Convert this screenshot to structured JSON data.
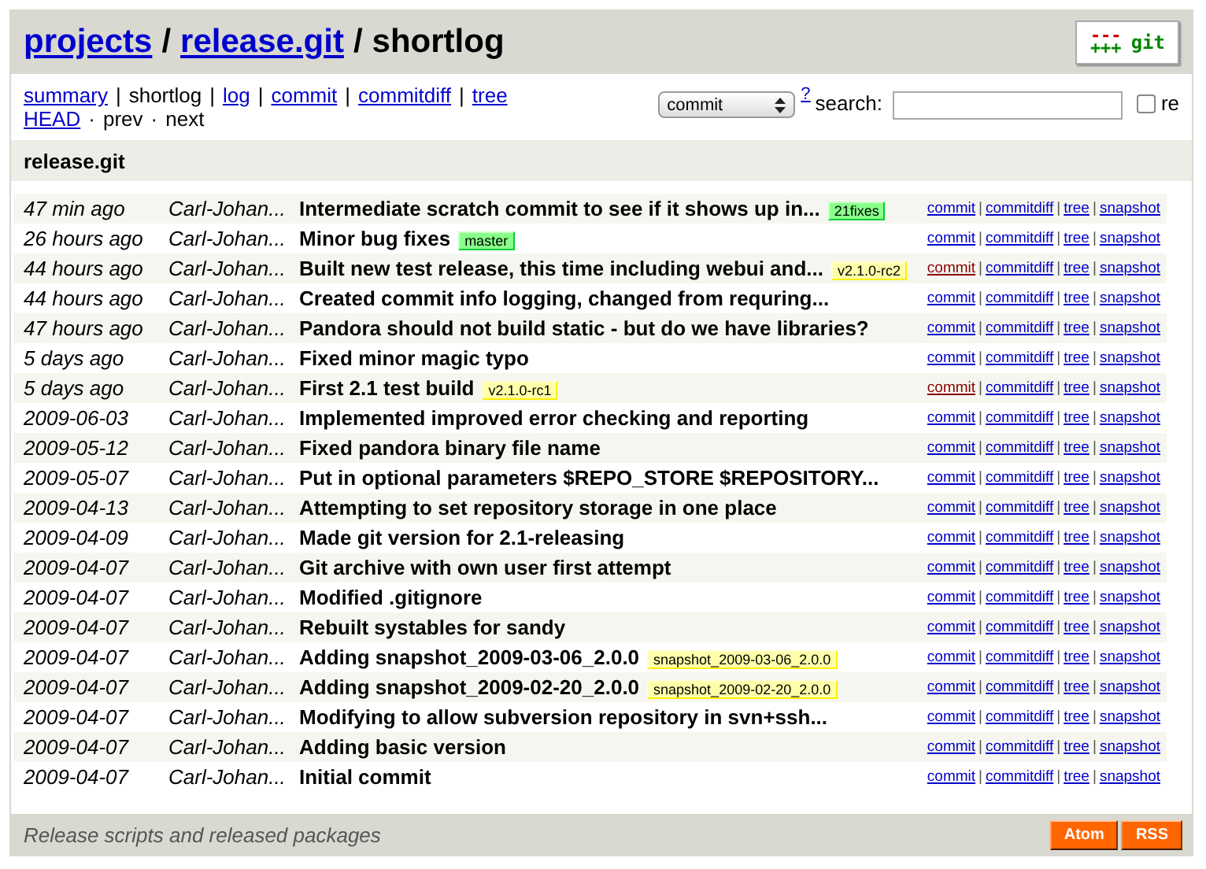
{
  "header": {
    "breadcrumbs": [
      {
        "text": "projects",
        "kind": "link"
      },
      {
        "text": "/",
        "kind": "separator"
      },
      {
        "text": "release.git",
        "kind": "link"
      },
      {
        "text": "/",
        "kind": "separator"
      },
      {
        "text": "shortlog",
        "kind": "current"
      }
    ],
    "logo": {
      "minus": "---",
      "plus": "+++",
      "text": "git"
    }
  },
  "nav": [
    [
      {
        "text": "summary",
        "kind": "link"
      },
      {
        "text": "|",
        "kind": "separator"
      },
      {
        "text": "shortlog",
        "kind": "current"
      },
      {
        "text": "|",
        "kind": "separator"
      },
      {
        "text": "log",
        "kind": "link"
      },
      {
        "text": "|",
        "kind": "separator"
      },
      {
        "text": "commit",
        "kind": "link"
      },
      {
        "text": "|",
        "kind": "separator"
      },
      {
        "text": "commitdiff",
        "kind": "link"
      },
      {
        "text": "|",
        "kind": "separator"
      },
      {
        "text": "tree",
        "kind": "link"
      }
    ],
    [
      {
        "text": "HEAD",
        "kind": "link"
      },
      {
        "text": "·",
        "kind": "separator"
      },
      {
        "text": "prev",
        "kind": "current"
      },
      {
        "text": "·",
        "kind": "separator"
      },
      {
        "text": "next",
        "kind": "current"
      }
    ]
  ],
  "search": {
    "type": "commit",
    "help": "?",
    "label": "search:",
    "regex_label": "re",
    "regex": false
  },
  "project_title": "release.git",
  "rows": [
    {
      "age": "47 min ago",
      "author": "Carl-Johan...",
      "subject": "Intermediate scratch commit to see if it shows up in...",
      "ref": {
        "text": "21fixes",
        "kind": "head"
      },
      "visited": false,
      "links": [
        "commit",
        "|",
        "commitdiff",
        "|",
        "tree",
        "|",
        "snapshot"
      ]
    },
    {
      "age": "26 hours ago",
      "author": "Carl-Johan...",
      "subject": "Minor bug fixes",
      "ref": {
        "text": "master",
        "kind": "head"
      },
      "visited": false,
      "links": [
        "commit",
        "|",
        "commitdiff",
        "|",
        "tree",
        "|",
        "snapshot"
      ]
    },
    {
      "age": "44 hours ago",
      "author": "Carl-Johan...",
      "subject": "Built new test release, this time including webui and...",
      "ref": {
        "text": "v2.1.0-rc2",
        "kind": "tag"
      },
      "visited": true,
      "links": [
        "commit",
        "|",
        "commitdiff",
        "|",
        "tree",
        "|",
        "snapshot"
      ]
    },
    {
      "age": "44 hours ago",
      "author": "Carl-Johan...",
      "subject": "Created commit info logging, changed from requring...",
      "visited": false,
      "links": [
        "commit",
        "|",
        "commitdiff",
        "|",
        "tree",
        "|",
        "snapshot"
      ]
    },
    {
      "age": "47 hours ago",
      "author": "Carl-Johan...",
      "subject": "Pandora should not build static - but do we have libraries?",
      "visited": false,
      "links": [
        "commit",
        "|",
        "commitdiff",
        "|",
        "tree",
        "|",
        "snapshot"
      ]
    },
    {
      "age": "5 days ago",
      "author": "Carl-Johan...",
      "subject": "Fixed minor magic typo",
      "visited": false,
      "links": [
        "commit",
        "|",
        "commitdiff",
        "|",
        "tree",
        "|",
        "snapshot"
      ]
    },
    {
      "age": "5 days ago",
      "author": "Carl-Johan...",
      "subject": "First 2.1 test build",
      "ref": {
        "text": "v2.1.0-rc1",
        "kind": "tag"
      },
      "visited": true,
      "links": [
        "commit",
        "|",
        "commitdiff",
        "|",
        "tree",
        "|",
        "snapshot"
      ]
    },
    {
      "age": "2009-06-03",
      "author": "Carl-Johan...",
      "subject": "Implemented improved error checking and reporting",
      "visited": false,
      "links": [
        "commit",
        "|",
        "commitdiff",
        "|",
        "tree",
        "|",
        "snapshot"
      ]
    },
    {
      "age": "2009-05-12",
      "author": "Carl-Johan...",
      "subject": "Fixed pandora binary file name",
      "visited": false,
      "links": [
        "commit",
        "|",
        "commitdiff",
        "|",
        "tree",
        "|",
        "snapshot"
      ]
    },
    {
      "age": "2009-05-07",
      "author": "Carl-Johan...",
      "subject": "Put in optional parameters $REPO_STORE $REPOSITORY...",
      "visited": false,
      "links": [
        "commit",
        "|",
        "commitdiff",
        "|",
        "tree",
        "|",
        "snapshot"
      ]
    },
    {
      "age": "2009-04-13",
      "author": "Carl-Johan...",
      "subject": "Attempting to set repository storage in one place",
      "visited": false,
      "links": [
        "commit",
        "|",
        "commitdiff",
        "|",
        "tree",
        "|",
        "snapshot"
      ]
    },
    {
      "age": "2009-04-09",
      "author": "Carl-Johan...",
      "subject": "Made git version for 2.1-releasing",
      "visited": false,
      "links": [
        "commit",
        "|",
        "commitdiff",
        "|",
        "tree",
        "|",
        "snapshot"
      ]
    },
    {
      "age": "2009-04-07",
      "author": "Carl-Johan...",
      "subject": "Git archive with own user first attempt",
      "visited": false,
      "links": [
        "commit",
        "|",
        "commitdiff",
        "|",
        "tree",
        "|",
        "snapshot"
      ]
    },
    {
      "age": "2009-04-07",
      "author": "Carl-Johan...",
      "subject": "Modified .gitignore",
      "visited": false,
      "links": [
        "commit",
        "|",
        "commitdiff",
        "|",
        "tree",
        "|",
        "snapshot"
      ]
    },
    {
      "age": "2009-04-07",
      "author": "Carl-Johan...",
      "subject": "Rebuilt systables for sandy",
      "visited": false,
      "links": [
        "commit",
        "|",
        "commitdiff",
        "|",
        "tree",
        "|",
        "snapshot"
      ]
    },
    {
      "age": "2009-04-07",
      "author": "Carl-Johan...",
      "subject": "Adding snapshot_2009-03-06_2.0.0",
      "ref": {
        "text": "snapshot_2009-03-06_2.0.0",
        "kind": "tag"
      },
      "visited": false,
      "links": [
        "commit",
        "|",
        "commitdiff",
        "|",
        "tree",
        "|",
        "snapshot"
      ]
    },
    {
      "age": "2009-04-07",
      "author": "Carl-Johan...",
      "subject": "Adding snapshot_2009-02-20_2.0.0",
      "ref": {
        "text": "snapshot_2009-02-20_2.0.0",
        "kind": "tag"
      },
      "visited": false,
      "links": [
        "commit",
        "|",
        "commitdiff",
        "|",
        "tree",
        "|",
        "snapshot"
      ]
    },
    {
      "age": "2009-04-07",
      "author": "Carl-Johan...",
      "subject": "Modifying to allow subversion repository in svn+ssh...",
      "visited": false,
      "links": [
        "commit",
        "|",
        "commitdiff",
        "|",
        "tree",
        "|",
        "snapshot"
      ]
    },
    {
      "age": "2009-04-07",
      "author": "Carl-Johan...",
      "subject": "Adding basic version",
      "visited": false,
      "links": [
        "commit",
        "|",
        "commitdiff",
        "|",
        "tree",
        "|",
        "snapshot"
      ]
    },
    {
      "age": "2009-04-07",
      "author": "Carl-Johan...",
      "subject": "Initial commit",
      "visited": false,
      "links": [
        "commit",
        "|",
        "commitdiff",
        "|",
        "tree",
        "|",
        "snapshot"
      ]
    }
  ],
  "footer": {
    "description": "Release scripts and released packages",
    "feeds": [
      "Atom",
      "RSS"
    ]
  }
}
